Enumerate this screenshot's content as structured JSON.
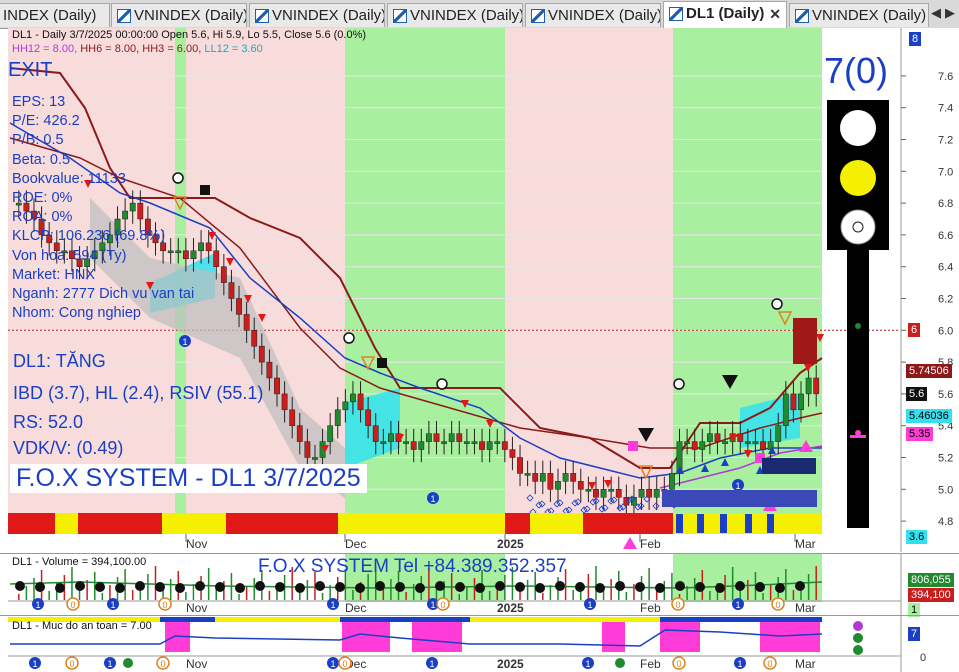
{
  "tabs": [
    {
      "label": "INDEX (Daily)"
    },
    {
      "label": "VNINDEX (Daily)"
    },
    {
      "label": "VNINDEX (Daily)"
    },
    {
      "label": "VNINDEX (Daily)"
    },
    {
      "label": "VNINDEX (Daily)"
    },
    {
      "label": "DL1 (Daily)"
    },
    {
      "label": "VNINDEX (Daily)"
    }
  ],
  "header": {
    "line1": "DL1 - Daily 3/7/2025 00:00:00 Open 5.6, Hi 5.9, Lo 5.5, Close 5.6 (0.0%)",
    "hh12": "HH12 = 8.00,",
    "hh6": "HH6 = 8.00,",
    "hh3": "HH3 = 6.00,",
    "ll12": "LL12 = 3.60"
  },
  "fundamentals": {
    "exit": "EXIT",
    "rows": [
      "EPS: 13",
      "P/E: 426.2",
      "P/B: 0.5",
      "Beta: 0.5",
      "Bookvalue: 11133",
      "ROE: 0%",
      "ROA: 0%",
      "KLCP: 106.236 (69.8%)",
      "Von hoa: 594 (Ty)",
      "Market: HNX",
      "Nganh: 2777 Dich vu van tai",
      "Nhom: Cong nghiep"
    ],
    "trend": "DL1: TĂNG",
    "ibd": "IBD (3.7), HL (2.4), RSIV (55.1)",
    "rs": "RS: 52.0",
    "vdk": "VDK/V:  (0.49)",
    "brand": "F.O.X SYSTEM - DL1 3/7/2025"
  },
  "signal_count": "7(0)",
  "colors": {
    "up": "#1f8a2e",
    "down": "#c81e1e",
    "cloud": "#33e0f0",
    "band_red": "#f8dcdc",
    "band_green": "#a8f0a0",
    "yaxis_text": "#333333"
  },
  "chart_data": {
    "type": "candlestick",
    "symbol": "DL1",
    "interval": "Daily",
    "ylim": [
      4.7,
      7.75
    ],
    "yticks": [
      4.8,
      5.0,
      5.2,
      5.4,
      5.6,
      5.8,
      6.0,
      6.2,
      6.4,
      6.6,
      6.8,
      7.0,
      7.2,
      7.4,
      7.6
    ],
    "x_labels": [
      "Nov",
      "Dec",
      "2025",
      "Feb",
      "Mar"
    ],
    "last_bar": {
      "date": "3/7/2025",
      "open": 5.6,
      "high": 5.9,
      "low": 5.5,
      "close": 5.6,
      "change": "0.0%"
    },
    "price_tags": [
      {
        "label": "6",
        "value": 6.0,
        "bg": "#c81e1e",
        "fg": "#ffffff"
      },
      {
        "label": "5.74506",
        "value": 5.74506,
        "bg": "#8b1a1a",
        "fg": "#ffffff"
      },
      {
        "label": "5.6",
        "value": 5.6,
        "bg": "#111111",
        "fg": "#ffffff"
      },
      {
        "label": "5.46036",
        "value": 5.46036,
        "bg": "#33e0f0",
        "fg": "#000000"
      },
      {
        "label": "5.35",
        "value": 5.35,
        "bg": "#ff3bd8",
        "fg": "#000000"
      },
      {
        "label": "3.6",
        "value": 3.6,
        "bg": "#33e0f0",
        "fg": "#000000"
      }
    ],
    "close_series": [
      6.8,
      6.75,
      6.7,
      6.6,
      6.55,
      6.5,
      6.5,
      6.45,
      6.4,
      6.45,
      6.5,
      6.55,
      6.6,
      6.7,
      6.75,
      6.8,
      6.7,
      6.6,
      6.55,
      6.5,
      6.5,
      6.5,
      6.45,
      6.5,
      6.55,
      6.5,
      6.4,
      6.3,
      6.2,
      6.1,
      6.0,
      5.9,
      5.8,
      5.7,
      5.6,
      5.5,
      5.4,
      5.3,
      5.2,
      5.2,
      5.3,
      5.4,
      5.5,
      5.55,
      5.6,
      5.5,
      5.4,
      5.3,
      5.3,
      5.35,
      5.3,
      5.3,
      5.25,
      5.3,
      5.35,
      5.3,
      5.3,
      5.35,
      5.3,
      5.3,
      5.3,
      5.25,
      5.3,
      5.3,
      5.25,
      5.2,
      5.1,
      5.1,
      5.05,
      5.1,
      5.0,
      5.05,
      5.1,
      5.05,
      5.0,
      5.0,
      4.95,
      5.0,
      5.0,
      4.95,
      4.9,
      4.95,
      5.0,
      4.95,
      5.0,
      5.0,
      5.1,
      5.3,
      5.3,
      5.25,
      5.3,
      5.35,
      5.3,
      5.3,
      5.35,
      5.3,
      5.3,
      5.3,
      5.25,
      5.3,
      5.4,
      5.6,
      5.5,
      5.6,
      5.7,
      5.6
    ]
  },
  "volume_panel": {
    "title": "DL1 - Volume = 394,100.00",
    "brand": "F.O.X SYSTEM Tel +84.389.352.357",
    "x_labels": [
      "Nov",
      "Dec",
      "2025",
      "Feb",
      "Mar"
    ],
    "tags": [
      {
        "label": "806,055",
        "bg": "#1f8a2e",
        "fg": "#ffffff"
      },
      {
        "label": "394,100",
        "bg": "#c81e1e",
        "fg": "#ffffff"
      },
      {
        "label": "1",
        "bg": "#a8f0a0",
        "fg": "#000000"
      }
    ]
  },
  "safety_panel": {
    "title": "DL1 - Muc do an toan = 7.00",
    "x_labels": [
      "Nov",
      "Dec",
      "2025",
      "Feb",
      "Mar"
    ],
    "tags": [
      {
        "label": "7",
        "bg": "#1a3fc4",
        "fg": "#ffffff"
      },
      {
        "label": "0",
        "bg": "#ffffff",
        "fg": "#333333"
      }
    ]
  },
  "markers": {
    "one": "1",
    "zero": "0",
    "eight": "8"
  }
}
